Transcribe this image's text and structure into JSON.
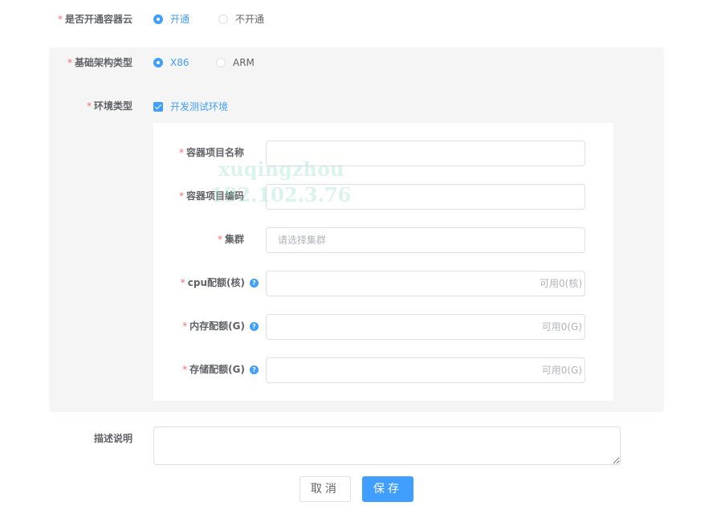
{
  "form": {
    "enable_container": {
      "label": "是否开通容器云",
      "options": [
        {
          "label": "开通",
          "checked": true
        },
        {
          "label": "不开通",
          "checked": false
        }
      ]
    },
    "arch_type": {
      "label": "基础架构类型",
      "options": [
        {
          "label": "X86",
          "checked": true
        },
        {
          "label": "ARM",
          "checked": false
        }
      ]
    },
    "env_type": {
      "label": "环境类型",
      "option": {
        "label": "开发测试环境",
        "checked": true
      }
    },
    "project_name": {
      "label": "容器项目名称",
      "value": ""
    },
    "project_code": {
      "label": "容器项目编码",
      "value": ""
    },
    "cluster": {
      "label": "集群",
      "placeholder": "请选择集群"
    },
    "cpu_quota": {
      "label": "cpu配额(核)",
      "suffix": "可用0(核)"
    },
    "mem_quota": {
      "label": "内存配额(G)",
      "suffix": "可用0(G)"
    },
    "storage_quota": {
      "label": "存储配额(G)",
      "suffix": "可用0(G)"
    },
    "description": {
      "label": "描述说明",
      "value": ""
    }
  },
  "required_mark": "*",
  "help_glyph": "?",
  "buttons": {
    "cancel": "取消",
    "save": "保存"
  },
  "watermark": {
    "line1": "xuqingzhou",
    "line2": "192.102.3.76"
  },
  "colors": {
    "accent": "#409eff",
    "required": "#f56c6c",
    "panel": "#f5f5f5"
  }
}
